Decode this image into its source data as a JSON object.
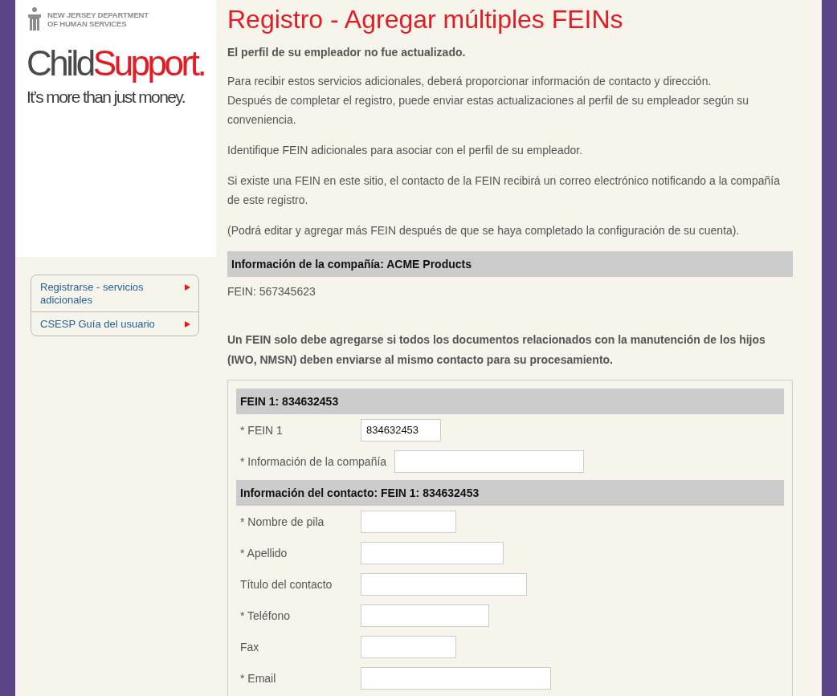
{
  "logo": {
    "agency": [
      "NEW JERSEY DEPARTMENT",
      "OF HUMAN SERVICES"
    ],
    "brand_first": "Child",
    "brand_second": "Support.",
    "tagline": "It’s more than just money."
  },
  "sidebar": {
    "items": [
      {
        "label": "Registrarse - servicios adicionales"
      },
      {
        "label": "CSESP Guía del usuario"
      }
    ]
  },
  "page_title": "Registro - Agregar múltiples FEINs",
  "notice": "El perfil de su empleador no fue actualizado.",
  "paragraphs": [
    [
      "Para recibir estos servicios adicionales, deberá proporcionar información de contacto y dirección.",
      "Después de completar el registro, puede enviar estas actualizaciones al perfil de su empleador según su conveniencia."
    ],
    [
      "Identifique FEIN adicionales para asociar con el perfil de su empleador."
    ],
    [
      "Si existe una FEIN en este sitio, el contacto de la FEIN recibirá un correo electrónico notificando a la compañía de este registro."
    ],
    [
      "(Podrá editar y agregar más FEIN después de que se haya completado la configuración de su cuenta)."
    ]
  ],
  "company": {
    "header": "Información de la compañía: ACME Products",
    "fein": "FEIN: 567345623"
  },
  "warning": "Un FEIN solo debe agregarse si todos los documentos relacionados con la manutención de los hijos (IWO, NMSN) deben enviarse al mismo contacto para su procesamiento.",
  "form": [
    {
      "kind": "header",
      "text": "FEIN 1: 834632453"
    },
    {
      "kind": "field",
      "label": "* FEIN 1",
      "value": "834632453"
    },
    {
      "kind": "field",
      "label": "* Información de la compañía",
      "inline": true
    },
    {
      "kind": "header",
      "text": "Información del contacto: FEIN 1: 834632453"
    },
    {
      "kind": "field",
      "label": "* Nombre de pila"
    },
    {
      "kind": "field",
      "label": "* Apellido"
    },
    {
      "kind": "field",
      "label": "Título del contacto"
    },
    {
      "kind": "field",
      "label": "* Teléfono"
    },
    {
      "kind": "field",
      "label": "Fax"
    },
    {
      "kind": "field",
      "label": "* Email"
    }
  ]
}
